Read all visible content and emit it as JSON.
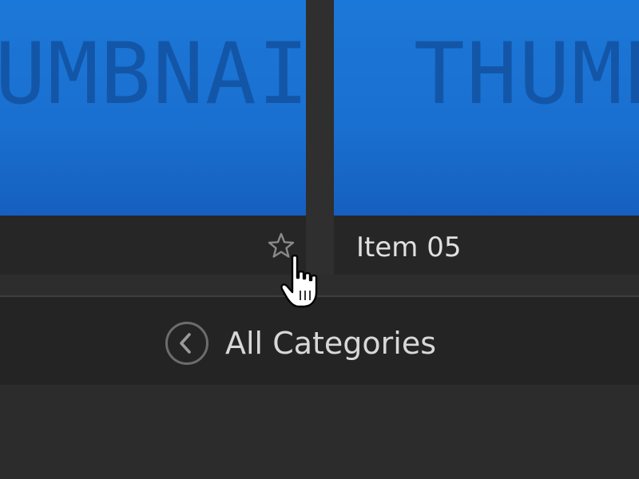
{
  "cards": [
    {
      "thumbnail_text": "THUMBNAIL"
    },
    {
      "thumbnail_text": "THUMBNAIL",
      "label": "Item 05"
    }
  ],
  "nav": {
    "back_label": "All Categories"
  },
  "icons": {
    "star": "star-outline-icon",
    "back": "chevron-left-circle-icon",
    "cursor": "hand-pointer-icon"
  },
  "colors": {
    "thumbnail": "#1a70d0",
    "background": "#2b2b2b",
    "text": "#e0e0e0"
  }
}
